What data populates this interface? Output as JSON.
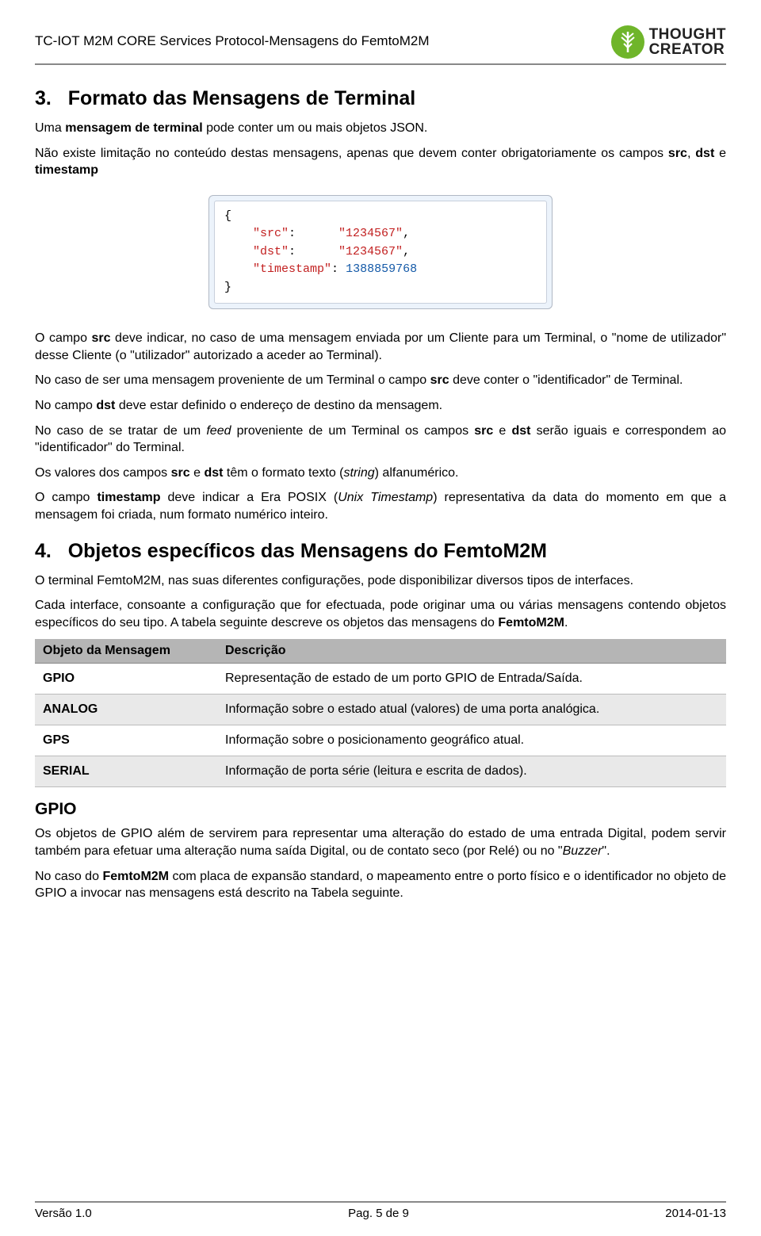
{
  "header": {
    "doc_title": "TC-IOT M2M CORE Services Protocol-Mensagens do FemtoM2M",
    "brand_line1": "THOUGHT",
    "brand_line2": "CREATOR"
  },
  "section3": {
    "number": "3.",
    "title": "Formato das Mensagens de Terminal",
    "p1_a": "Uma ",
    "p1_b": "mensagem de terminal",
    "p1_c": " pode conter um ou mais objetos JSON.",
    "p2_a": "Não existe limitação no conteúdo destas mensagens, apenas que devem conter obrigatoriamente os campos ",
    "p2_src": "src",
    "p2_sep1": ", ",
    "p2_dst": "dst",
    "p2_sep2": " e ",
    "p2_ts": "timestamp",
    "code": {
      "k_src": "\"src\"",
      "v_src": "\"1234567\"",
      "k_dst": "\"dst\"",
      "v_dst": "\"1234567\"",
      "k_ts": "\"timestamp\"",
      "v_ts": "1388859768"
    },
    "p3_a": "O campo ",
    "p3_src": "src",
    "p3_b": " deve indicar, no caso de uma mensagem enviada por um Cliente para um Terminal, o \"nome de utilizador\" desse Cliente (o \"utilizador\" autorizado a aceder ao Terminal).",
    "p4_a": "No caso de ser uma mensagem proveniente de um Terminal o campo ",
    "p4_src": "src",
    "p4_b": " deve conter o \"identificador\" de Terminal.",
    "p5_a": "No campo ",
    "p5_dst": "dst",
    "p5_b": " deve estar definido o endereço de destino da mensagem.",
    "p6_a": "No caso de se tratar de um ",
    "p6_feed": "feed",
    "p6_b": " proveniente de um Terminal os campos ",
    "p6_src": "src",
    "p6_c": " e ",
    "p6_dst": "dst",
    "p6_d": " serão iguais e correspondem ao \"identificador\" do Terminal.",
    "p7_a": "Os valores dos campos ",
    "p7_src": "src",
    "p7_b": " e ",
    "p7_dst": "dst",
    "p7_c": " têm o formato texto (",
    "p7_string": "string",
    "p7_d": ") alfanumérico.",
    "p8_a": "O campo ",
    "p8_ts": "timestamp",
    "p8_b": " deve indicar a Era POSIX (",
    "p8_ux": "Unix Timestamp",
    "p8_c": ") representativa da data do momento em que a mensagem foi criada, num formato numérico inteiro."
  },
  "section4": {
    "number": "4.",
    "title": "Objetos específicos das Mensagens do FemtoM2M",
    "p1": "O terminal FemtoM2M, nas suas diferentes configurações, pode disponibilizar diversos tipos de interfaces.",
    "p2_a": "Cada interface, consoante a configuração que for efectuada, pode originar uma ou várias mensagens contendo objetos específicos do seu tipo. A tabela seguinte descreve os objetos das mensagens do ",
    "p2_b": "FemtoM2M",
    "p2_c": ".",
    "table": {
      "h1": "Objeto da Mensagem",
      "h2": "Descrição",
      "rows": [
        {
          "k": "GPIO",
          "v": "Representação de estado de um porto GPIO de Entrada/Saída."
        },
        {
          "k": "ANALOG",
          "v": "Informação sobre o estado atual (valores) de uma porta analógica."
        },
        {
          "k": "GPS",
          "v": "Informação sobre o posicionamento geográfico atual."
        },
        {
          "k": "SERIAL",
          "v": "Informação de porta série (leitura e escrita de dados)."
        }
      ]
    }
  },
  "gpio": {
    "title": "GPIO",
    "p1_a": "Os objetos de GPIO além de servirem para representar uma alteração do estado de uma entrada Digital, podem servir também para efetuar uma alteração numa saída Digital, ou de contato seco (por Relé) ou no \"",
    "p1_buzzer": "Buzzer",
    "p1_b": "\".",
    "p2_a": "No caso do ",
    "p2_fm": "FemtoM2M",
    "p2_b": " com placa de expansão standard, o mapeamento entre o porto físico e o identificador no objeto de GPIO a invocar nas mensagens está descrito na Tabela seguinte."
  },
  "footer": {
    "left": "Versão 1.0",
    "center": "Pag. 5 de 9",
    "right": "2014-01-13"
  }
}
